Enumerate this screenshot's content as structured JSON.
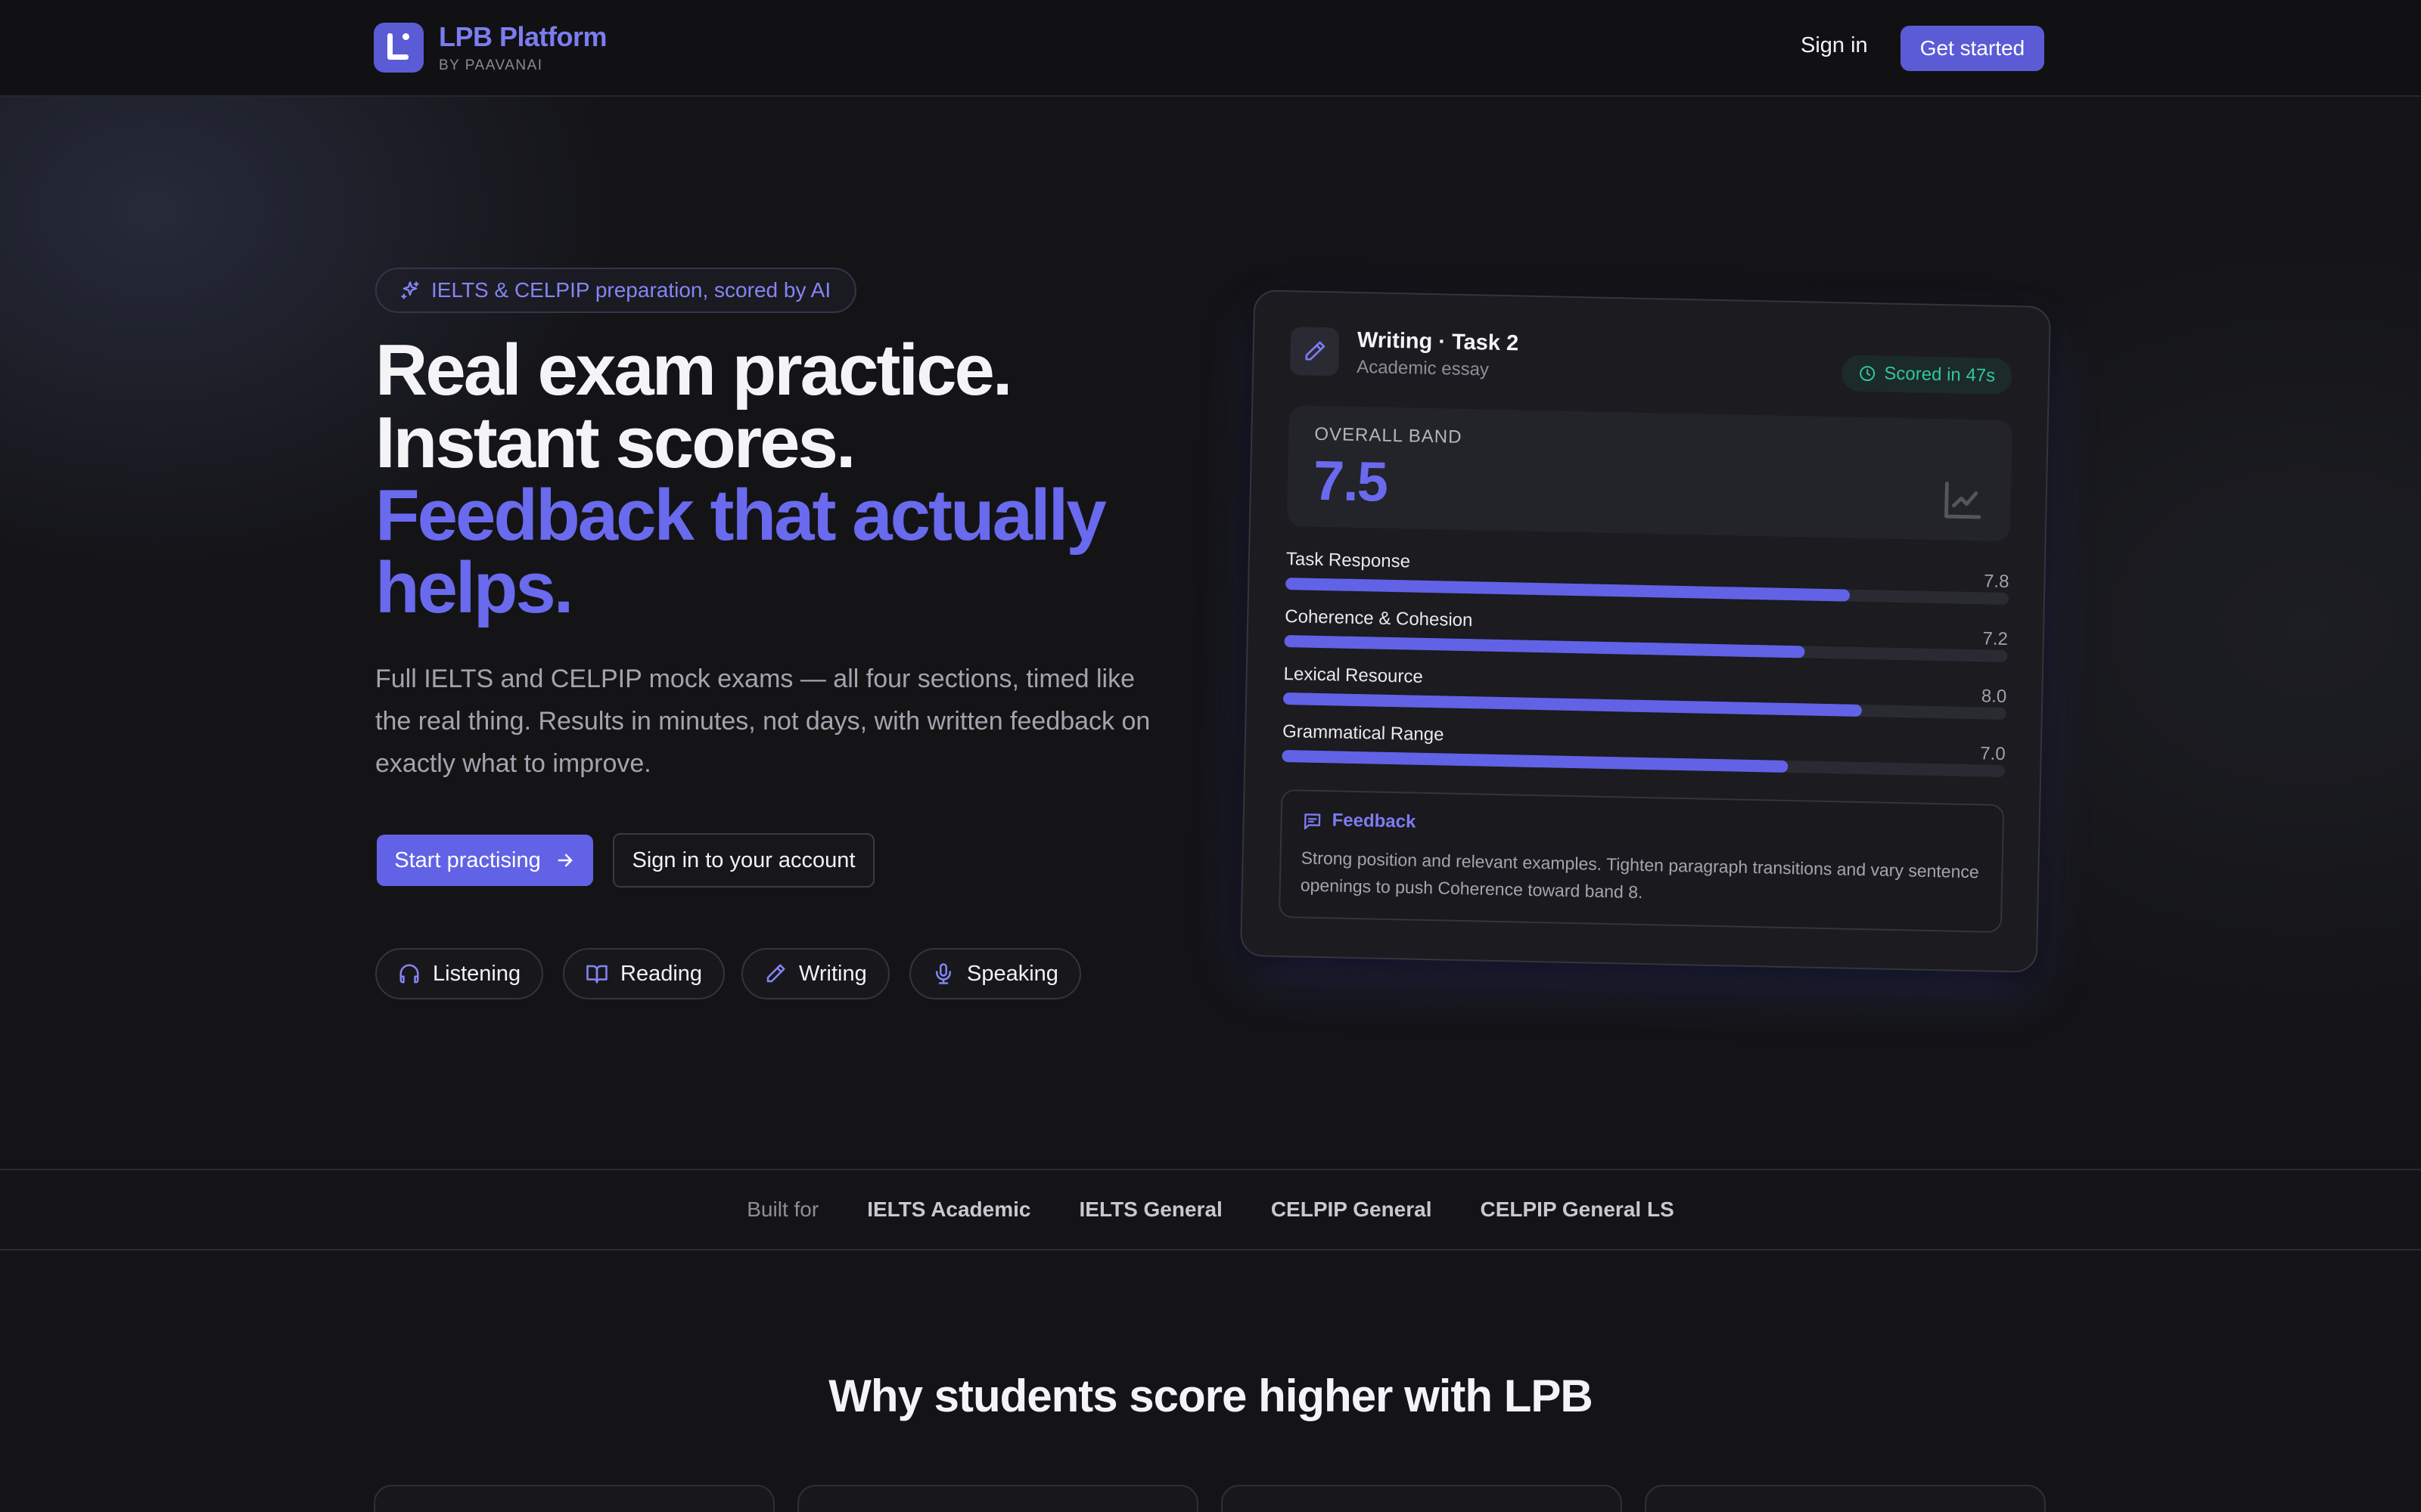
{
  "nav": {
    "brand_name": "LPB Platform",
    "brand_sub": "BY PAAVANAI",
    "signin_label": "Sign in",
    "cta_label": "Get started"
  },
  "hero": {
    "pill_text": "IELTS & CELPIP preparation, scored by AI",
    "headline_line1": "Real exam practice.",
    "headline_line2": "Instant scores.",
    "headline_accent1": "Feedback that actually",
    "headline_accent2": "helps.",
    "description": "Full IELTS and CELPIP mock exams — all four sections, timed like the real thing. Results in minutes, not days, with written feedback on exactly what to improve.",
    "primary_button": "Start practising",
    "secondary_button": "Sign in to your account",
    "chips": [
      {
        "label": "Listening",
        "icon": "headphones-icon"
      },
      {
        "label": "Reading",
        "icon": "book-open-icon"
      },
      {
        "label": "Writing",
        "icon": "pencil-icon"
      },
      {
        "label": "Speaking",
        "icon": "microphone-icon"
      }
    ]
  },
  "card": {
    "title": "Writing · Task 2",
    "subtitle": "Academic essay",
    "scored": "Scored in 47s",
    "band_label": "OVERALL BAND",
    "band_value": "7.5",
    "criteria": [
      {
        "label": "Task Response",
        "value": "7.8",
        "fill": 0.78
      },
      {
        "label": "Coherence & Cohesion",
        "value": "7.2",
        "fill": 0.72
      },
      {
        "label": "Lexical Resource",
        "value": "8.0",
        "fill": 0.8
      },
      {
        "label": "Grammatical Range",
        "value": "7.0",
        "fill": 0.7
      }
    ],
    "feedback_title": "Feedback",
    "feedback_text": "Strong position and relevant examples. Tighten paragraph transitions and vary sentence openings to push Coherence toward band 8."
  },
  "built_for": {
    "lead": "Built for",
    "items": [
      "IELTS Academic",
      "IELTS General",
      "CELPIP General",
      "CELPIP General LS"
    ]
  },
  "why": {
    "title": "Why students score higher with LPB"
  },
  "colors": {
    "accent": "#6262e6",
    "success": "#2fc79a",
    "background": "#141417"
  }
}
